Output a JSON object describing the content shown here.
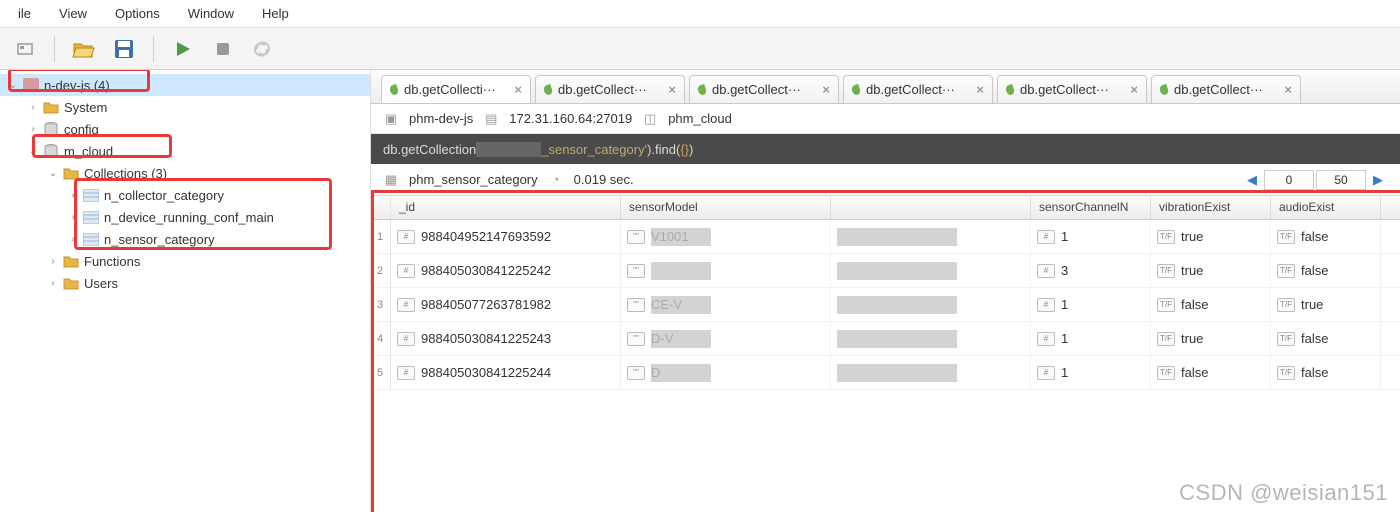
{
  "menu": {
    "items": [
      "ile",
      "View",
      "Options",
      "Window",
      "Help"
    ]
  },
  "tree": {
    "root": "n-dev-js (4)",
    "nodes": [
      {
        "label": "System",
        "level": 1,
        "exp": "›",
        "icon": "folder"
      },
      {
        "label": "config",
        "level": 1,
        "exp": "›",
        "icon": "db"
      },
      {
        "label": "m_cloud",
        "level": 1,
        "exp": "⌄",
        "icon": "db"
      },
      {
        "label": "Collections (3)",
        "level": 2,
        "exp": "⌄",
        "icon": "folder"
      },
      {
        "label": "n_collector_category",
        "level": 3,
        "exp": "›",
        "icon": "coll"
      },
      {
        "label": "n_device_running_conf_main",
        "level": 3,
        "exp": "›",
        "icon": "coll"
      },
      {
        "label": "n_sensor_category",
        "level": 3,
        "exp": "›",
        "icon": "coll"
      },
      {
        "label": "Functions",
        "level": 2,
        "exp": "›",
        "icon": "folder"
      },
      {
        "label": "Users",
        "level": 2,
        "exp": "›",
        "icon": "folder"
      }
    ]
  },
  "tabs": [
    {
      "label": "db.getCollecti···"
    },
    {
      "label": "db.getCollect···"
    },
    {
      "label": "db.getCollect···"
    },
    {
      "label": "db.getCollect···"
    },
    {
      "label": "db.getCollect···"
    },
    {
      "label": "db.getCollect···"
    }
  ],
  "context": {
    "server": "phm-dev-js",
    "host": "172.31.160.64:27019",
    "db": "phm_cloud"
  },
  "query": {
    "prefix": "db.getCollection",
    "arg_tail": "_sensor_category'",
    "call": ".find",
    "params_open": "(",
    "braces": "{}",
    "params_close": ")"
  },
  "result": {
    "collection": "phm_sensor_category",
    "time": "0.019 sec.",
    "page_offset": "0",
    "page_limit": "50"
  },
  "columns": [
    "_id",
    "sensorModel",
    "",
    "sensorChannelN",
    "vibrationExist",
    "audioExist"
  ],
  "rows": [
    {
      "n": "1",
      "id": "988404952147693592",
      "model": "V1001",
      "ch": "1",
      "vib": "true",
      "aud": "false"
    },
    {
      "n": "2",
      "id": "988405030841225242",
      "model": "",
      "ch": "3",
      "vib": "true",
      "aud": "false"
    },
    {
      "n": "3",
      "id": "988405077263781982",
      "model": "CE-V",
      "ch": "1",
      "vib": "false",
      "aud": "true"
    },
    {
      "n": "4",
      "id": "988405030841225243",
      "model": "D-V",
      "ch": "1",
      "vib": "true",
      "aud": "false"
    },
    {
      "n": "5",
      "id": "988405030841225244",
      "model": "D",
      "ch": "1",
      "vib": "false",
      "aud": "false"
    }
  ],
  "watermark": "CSDN @weisian151"
}
